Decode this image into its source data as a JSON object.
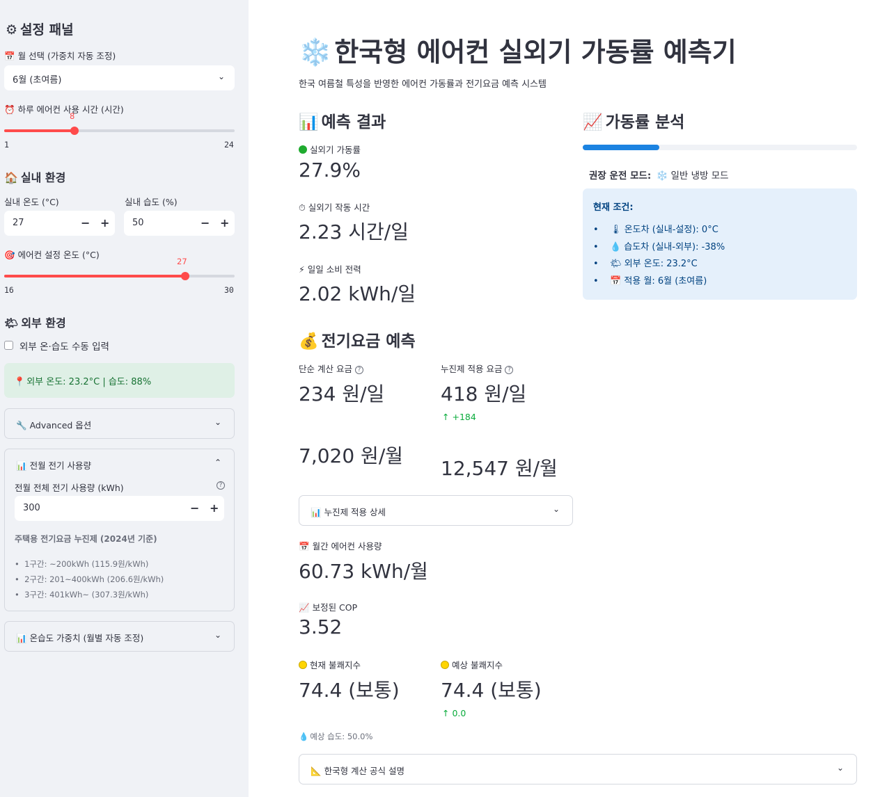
{
  "sidebar": {
    "title": "설정 패널",
    "month_label": "월 선택 (가중치 자동 조정)",
    "month_value": "6월 (초여름)",
    "hours_label": "하루 에어컨 사용 시간 (시간)",
    "hours_value": "8",
    "hours_min": "1",
    "hours_max": "24",
    "hours_fraction": 0.304,
    "indoor_title": "실내 환경",
    "indoor_temp_label": "실내 온도 (°C)",
    "indoor_temp_value": "27",
    "indoor_hum_label": "실내 습도 (%)",
    "indoor_hum_value": "50",
    "setpoint_label": "에어컨 설정 온도 (°C)",
    "setpoint_value": "27",
    "setpoint_min": "16",
    "setpoint_max": "30",
    "setpoint_fraction": 0.786,
    "outdoor_title": "외부 환경",
    "manual_checkbox_label": "외부 온·습도 수동 입력",
    "outdoor_info": "외부 온도: 23.2°C | 습도: 88%",
    "advanced_label": "Advanced 옵션",
    "prev_usage_title": "전월 전기 사용량",
    "prev_usage_label": "전월 전체 전기 사용량 (kWh)",
    "prev_usage_value": "300",
    "progressive_title": "주택용 전기요금 누진제 (2024년 기준)",
    "tiers": [
      "1구간: ~200kWh (115.9원/kWh)",
      "2구간: 201~400kWh (206.6원/kWh)",
      "3구간: 401kWh~ (307.3원/kWh)"
    ],
    "weights_label": "온습도 가중치 (월별 자동 조정)"
  },
  "main": {
    "title": "한국형 에어컨 실외기 가동률 예측기",
    "subtitle": "한국 여름철 특성을 반영한 에어컨 가동률과 전기요금 예측 시스템",
    "results_title": "예측 결과",
    "rate_label": "실외기 가동률",
    "rate_value": "27.9%",
    "time_label": "실외기 작동 시간",
    "time_value": "2.23 시간/일",
    "power_label": "일일 소비 전력",
    "power_value": "2.02 kWh/일",
    "fee_title": "전기요금 예측",
    "simple_fee_label": "단순 계산 요금",
    "simple_fee_value": "234 원/일",
    "prog_fee_label": "누진제 적용 요금",
    "prog_fee_value": "418 원/일",
    "prog_fee_delta": "+184",
    "simple_month_value": "7,020 원/월",
    "prog_month_value": "12,547 원/월",
    "prog_detail_label": "누진제 적용 상세",
    "monthly_usage_label": "월간 에어컨 사용량",
    "monthly_usage_value": "60.73 kWh/월",
    "cop_label": "보정된 COP",
    "cop_value": "3.52",
    "cur_di_label": "현재 불쾌지수",
    "cur_di_value": "74.4 (보통)",
    "exp_di_label": "예상 불쾌지수",
    "exp_di_value": "74.4 (보통)",
    "exp_di_delta": "0.0",
    "exp_hum": "예상 습도: 50.0%",
    "formula_label": "한국형 계산 공식 설명",
    "analysis_title": "가동률 분석",
    "progress_fraction": 0.279,
    "mode_label": "권장 운전 모드:",
    "mode_value": "일반 냉방 모드",
    "cond_title": "현재 조건:",
    "conditions": [
      "온도차 (실내-설정): 0°C",
      "습도차 (실내-외부): -38%",
      "외부 온도: 23.2°C",
      "적용 월: 6월 (초여름)"
    ]
  },
  "colors": {
    "accent": "#ff4b4b",
    "progress": "#1c83e1",
    "success_bg": "#dff0e6",
    "info_bg": "#e5f0fb",
    "delta_green": "#09ab3b"
  }
}
